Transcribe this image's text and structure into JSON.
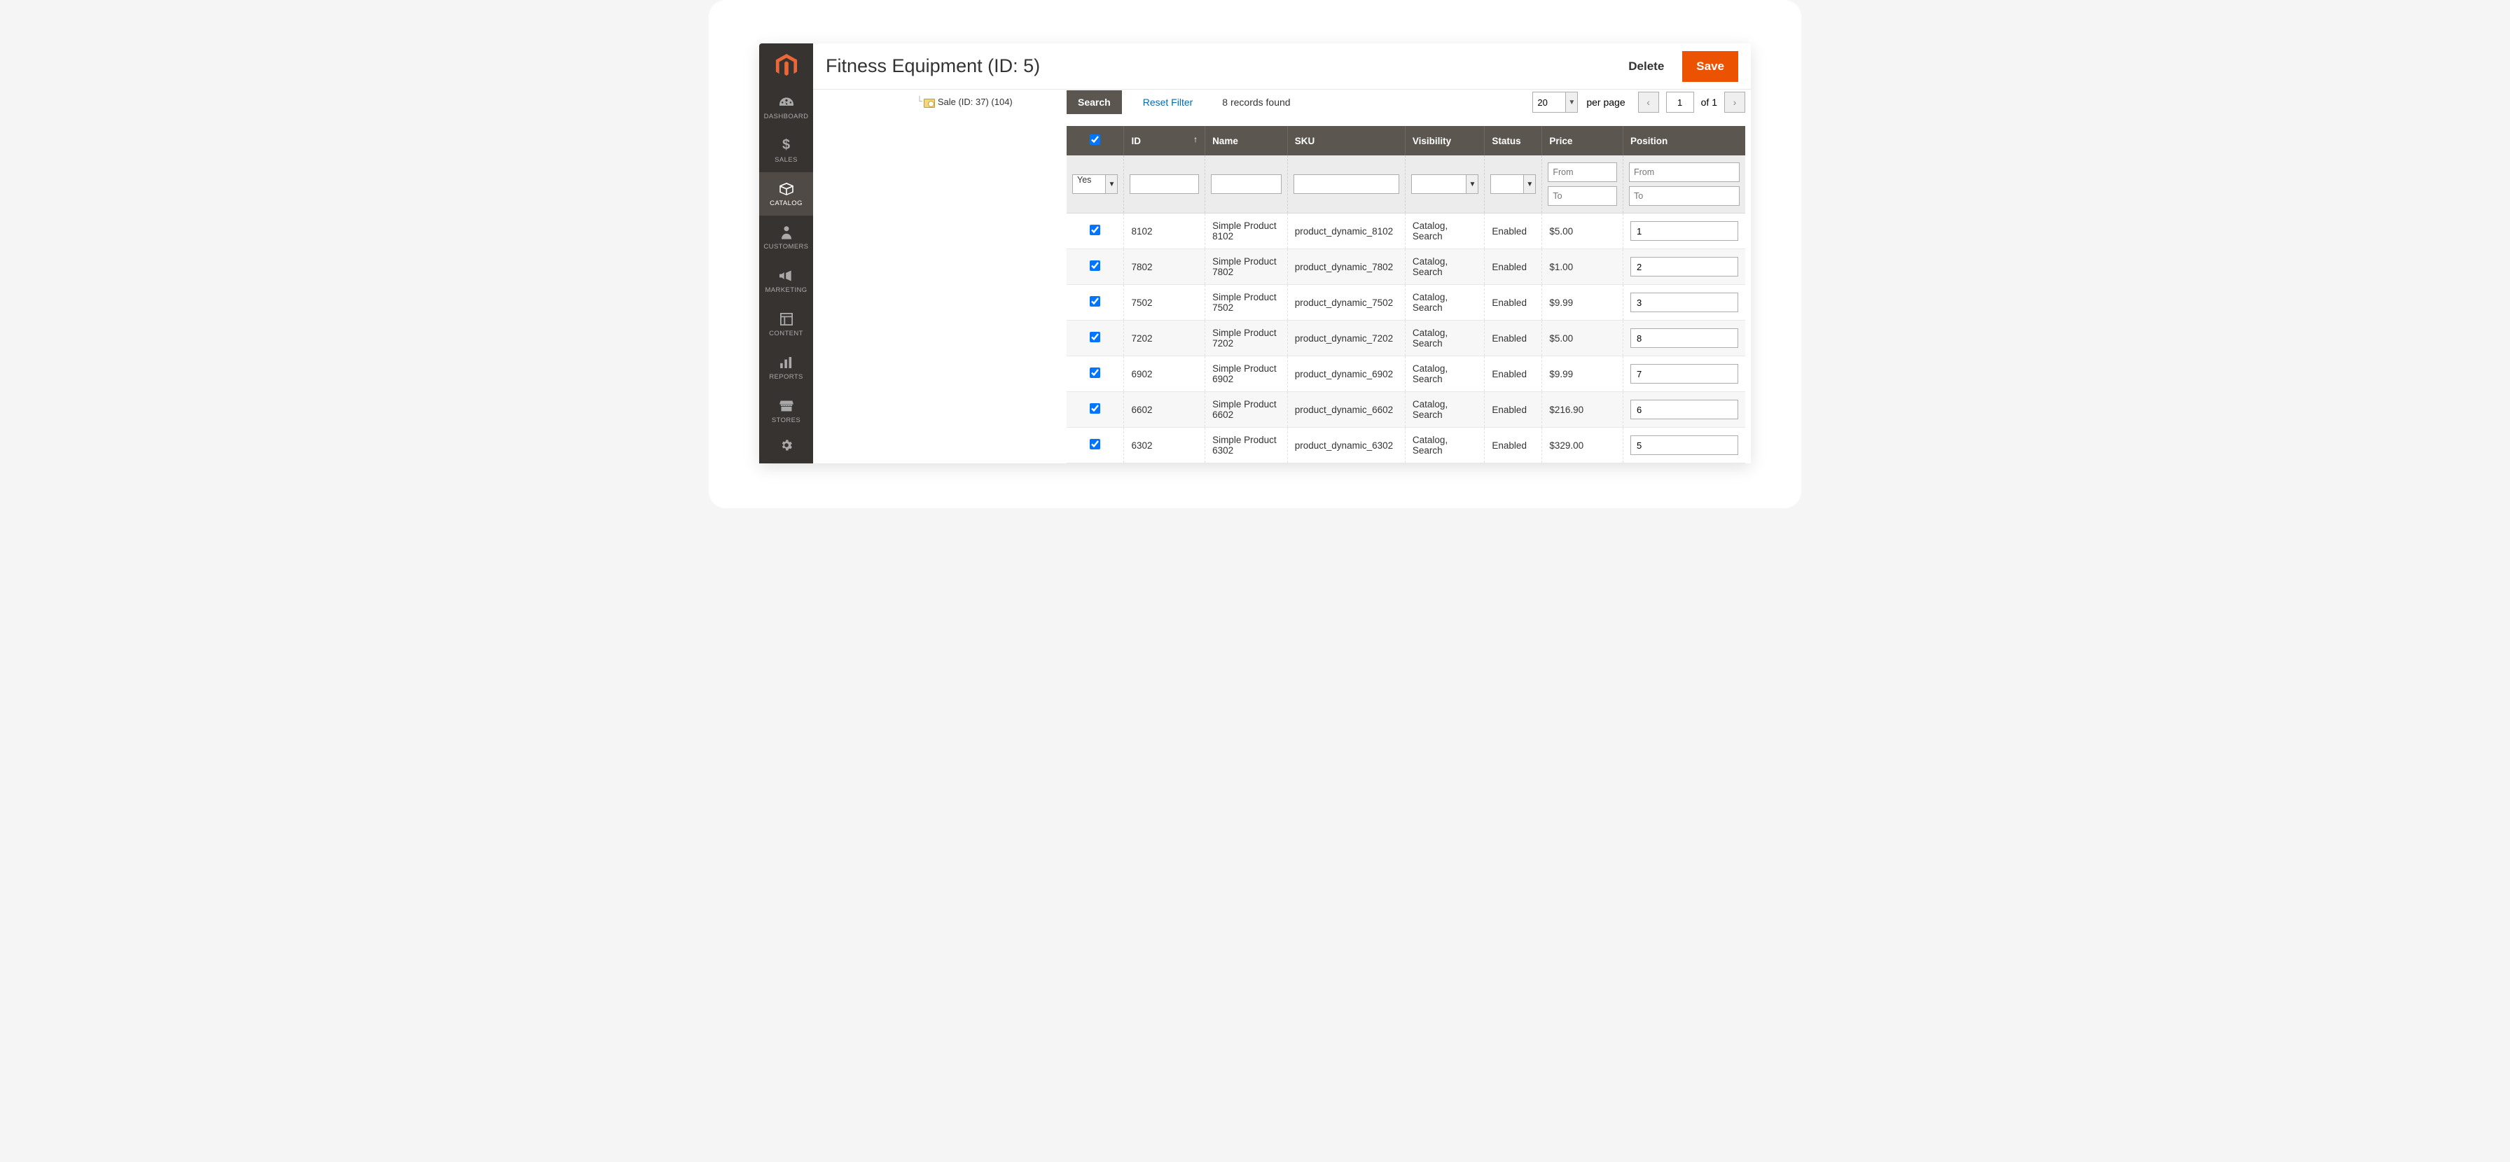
{
  "header": {
    "title": "Fitness Equipment (ID: 5)",
    "delete_label": "Delete",
    "save_label": "Save"
  },
  "sidebar": {
    "items": [
      {
        "label": "DASHBOARD",
        "icon": "dashboard"
      },
      {
        "label": "SALES",
        "icon": "dollar"
      },
      {
        "label": "CATALOG",
        "icon": "box",
        "active": true
      },
      {
        "label": "CUSTOMERS",
        "icon": "person"
      },
      {
        "label": "MARKETING",
        "icon": "megaphone"
      },
      {
        "label": "CONTENT",
        "icon": "layout"
      },
      {
        "label": "REPORTS",
        "icon": "bars"
      },
      {
        "label": "STORES",
        "icon": "store"
      }
    ]
  },
  "tree": {
    "item_label": "Sale (ID: 37) (104)"
  },
  "toolbar": {
    "search_label": "Search",
    "reset_label": "Reset Filter",
    "records_text": "8 records found",
    "per_page_value": "20",
    "per_page_label": "per page",
    "page_value": "1",
    "page_of": "of 1"
  },
  "columns": {
    "id": "ID",
    "name": "Name",
    "sku": "SKU",
    "visibility": "Visibility",
    "status": "Status",
    "price": "Price",
    "position": "Position"
  },
  "filters": {
    "select_value": "Yes",
    "from_placeholder": "From",
    "to_placeholder": "To"
  },
  "rows": [
    {
      "id": "8102",
      "name": "Simple Product 8102",
      "sku": "product_dynamic_8102",
      "visibility": "Catalog, Search",
      "status": "Enabled",
      "price": "$5.00",
      "position": "1"
    },
    {
      "id": "7802",
      "name": "Simple Product 7802",
      "sku": "product_dynamic_7802",
      "visibility": "Catalog, Search",
      "status": "Enabled",
      "price": "$1.00",
      "position": "2"
    },
    {
      "id": "7502",
      "name": "Simple Product 7502",
      "sku": "product_dynamic_7502",
      "visibility": "Catalog, Search",
      "status": "Enabled",
      "price": "$9.99",
      "position": "3"
    },
    {
      "id": "7202",
      "name": "Simple Product 7202",
      "sku": "product_dynamic_7202",
      "visibility": "Catalog, Search",
      "status": "Enabled",
      "price": "$5.00",
      "position": "8"
    },
    {
      "id": "6902",
      "name": "Simple Product 6902",
      "sku": "product_dynamic_6902",
      "visibility": "Catalog, Search",
      "status": "Enabled",
      "price": "$9.99",
      "position": "7"
    },
    {
      "id": "6602",
      "name": "Simple Product 6602",
      "sku": "product_dynamic_6602",
      "visibility": "Catalog, Search",
      "status": "Enabled",
      "price": "$216.90",
      "position": "6"
    },
    {
      "id": "6302",
      "name": "Simple Product 6302",
      "sku": "product_dynamic_6302",
      "visibility": "Catalog, Search",
      "status": "Enabled",
      "price": "$329.00",
      "position": "5"
    }
  ]
}
